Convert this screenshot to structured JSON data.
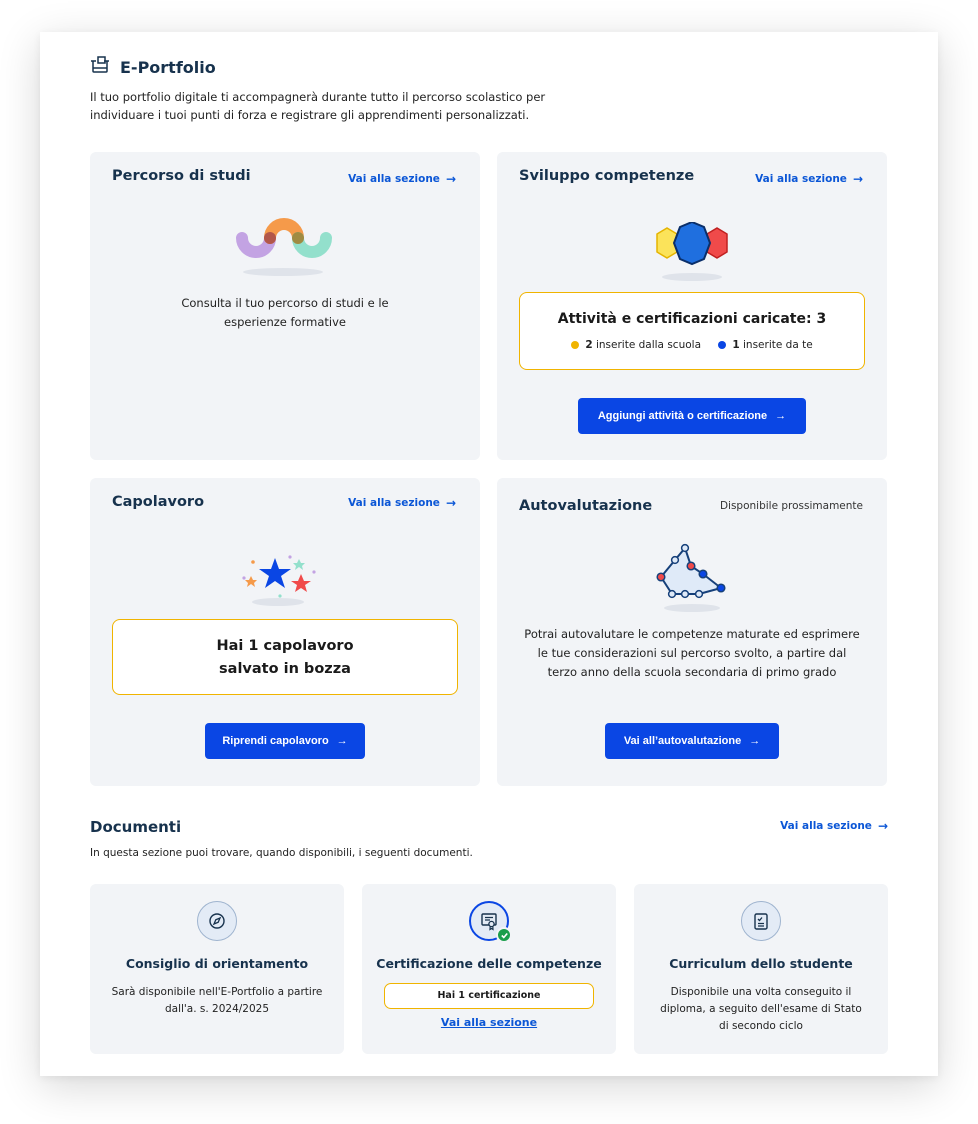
{
  "header": {
    "title": "E-Portfolio",
    "intro": "Il tuo portfolio digitale ti accompagnerà durante tutto il percorso scolastico per individuare i tuoi punti di forza e registrare gli apprendimenti personalizzati."
  },
  "cards": {
    "percorso": {
      "title": "Percorso di studi",
      "link": "Vai alla sezione",
      "text_line1": "Consulta il tuo percorso di studi e le",
      "text_line2": "esperienze formative"
    },
    "sviluppo": {
      "title": "Sviluppo competenze",
      "link": "Vai alla sezione",
      "summary": "Attività e certificazioni caricate: 3",
      "school_count": "2",
      "school_label": "inserite dalla scuola",
      "self_count": "1",
      "self_label": "inserite da te",
      "button": "Aggiungi attività o certificazione"
    },
    "capolavoro": {
      "title": "Capolavoro",
      "link": "Vai alla sezione",
      "box_line1": "Hai 1 capolavoro",
      "box_line2": "salvato in bozza",
      "button": "Riprendi capolavoro"
    },
    "autovalutazione": {
      "title": "Autovalutazione",
      "note": "Disponibile prossimamente",
      "text_line1": "Potrai autovalutare le competenze maturate ed esprimere",
      "text_line2": "le tue considerazioni sul percorso svolto, a partire dal",
      "text_line3": "terzo anno della scuola secondaria di primo grado",
      "button": "Vai all’autovalutazione"
    }
  },
  "documenti": {
    "title": "Documenti",
    "subtitle": "In questa sezione puoi trovare, quando disponibili, i seguenti documenti.",
    "link": "Vai alla sezione",
    "items": [
      {
        "title": "Consiglio di orientamento",
        "line1": "Sarà disponibile nell'E-Portfolio a partire",
        "line2": "dall'a. s. 2024/2025",
        "icon": "compass-icon"
      },
      {
        "title": "Certificazione delle competenze",
        "badge": "Hai 1 certificazione",
        "link": "Vai alla sezione",
        "icon": "certificate-icon"
      },
      {
        "title": "Curriculum dello studente",
        "line1": "Disponibile una volta conseguito il",
        "line2": "diploma, a seguito dell'esame di Stato",
        "line3": "di secondo ciclo",
        "icon": "checklist-icon"
      }
    ]
  },
  "arrow": "→",
  "colors": {
    "primary": "#0a46e4",
    "link": "#0b56d6",
    "accent_yellow": "#f0b400",
    "card_bg": "#f2f4f7",
    "heading": "#17324d"
  }
}
